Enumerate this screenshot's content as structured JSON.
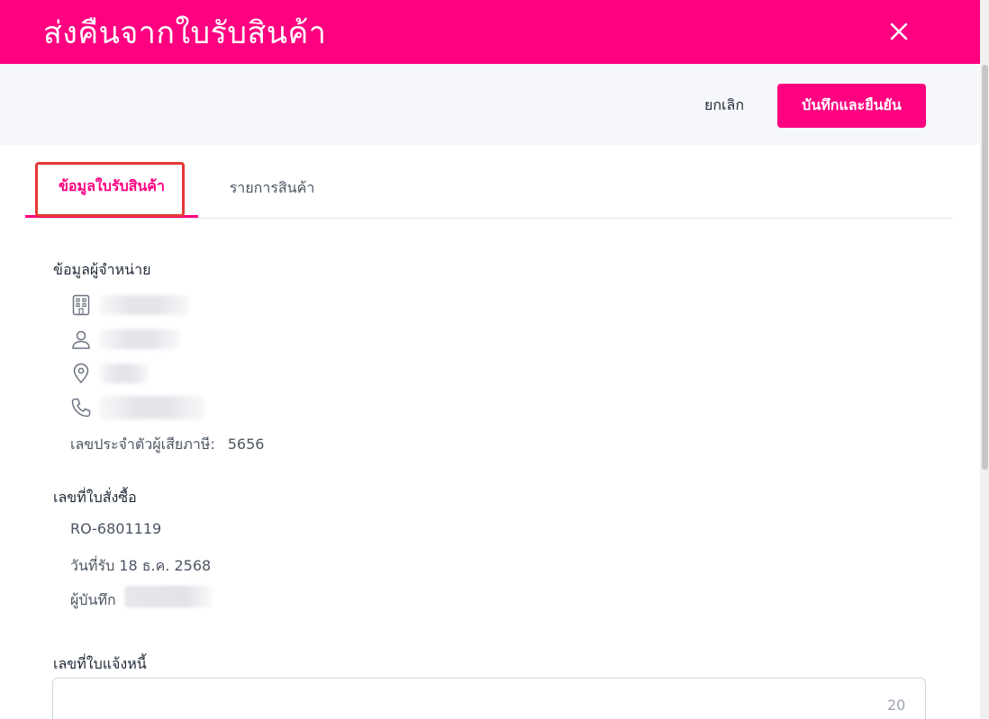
{
  "header": {
    "title": "ส่งคืนจากใบรับสินค้า",
    "close_icon": "close-icon",
    "color": "#ff0080"
  },
  "actions": {
    "cancel_label": "ยกเลิก",
    "save_label": "บันทึกและยืนยัน"
  },
  "tabs": [
    {
      "label": "ข้อมูลใบรับสินค้า",
      "active": true
    },
    {
      "label": "รายการสินค้า",
      "active": false
    }
  ],
  "supplier": {
    "section_title": "ข้อมูลผู้จำหน่าย",
    "icons": [
      "building-icon",
      "user-icon",
      "location-pin-icon",
      "phone-icon"
    ],
    "tax_id_label": "เลขประจำตัวผู้เสียภาษี:",
    "tax_id_value": "5656"
  },
  "purchase_order": {
    "section_title": "เลขที่ใบสั่งซื้อ",
    "number": "RO-6801119",
    "received_date": "วันที่รับ 18 ธ.ค. 2568",
    "recorder_label": "ผู้บันทึก"
  },
  "invoice": {
    "section_title": "เลขที่ใบแจ้งหนี้",
    "value": "",
    "char_limit": "20"
  },
  "colors": {
    "accent": "#ff0080",
    "highlight": "#e53935"
  }
}
